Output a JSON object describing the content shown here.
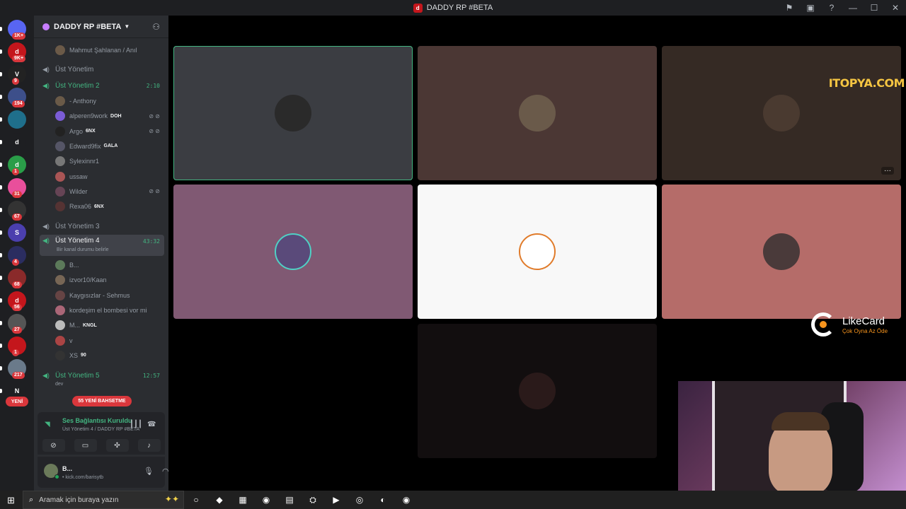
{
  "window": {
    "title": "DADDY RP #BETA",
    "controls": [
      "flag-icon",
      "monitor-icon",
      "help-icon",
      "minimize-icon",
      "maximize-icon",
      "close-icon"
    ]
  },
  "rail": {
    "servers": [
      {
        "label": "",
        "badge": "1K+",
        "color": "#5865f2"
      },
      {
        "label": "d",
        "badge": "9K+",
        "color": "#c4161c"
      },
      {
        "label": "V",
        "badge": "9",
        "color": "#222"
      },
      {
        "label": "",
        "badge": "194",
        "color": "#3d4f8a"
      },
      {
        "label": "",
        "badge": "",
        "color": "#1f6f8b"
      },
      {
        "label": "d",
        "badge": "",
        "color": "#1e1f22"
      },
      {
        "label": "d",
        "badge": "1",
        "color": "#2a9d48"
      },
      {
        "label": "",
        "badge": "31",
        "color": "#e94f9b"
      },
      {
        "label": "",
        "badge": "67",
        "color": "#333"
      },
      {
        "label": "S",
        "badge": "",
        "color": "#4b3fae"
      },
      {
        "label": "",
        "badge": "4",
        "color": "#2b2d60"
      },
      {
        "label": "",
        "badge": "68",
        "color": "#8a2a2a"
      },
      {
        "label": "d",
        "badge": "56",
        "color": "#c4161c"
      },
      {
        "label": "",
        "badge": "27",
        "color": "#555"
      },
      {
        "label": "",
        "badge": "1",
        "color": "#c4161c"
      },
      {
        "label": "",
        "badge": "217",
        "color": "#6a7a8a"
      },
      {
        "label": "N",
        "badge": "",
        "color": "#1e1f22"
      }
    ],
    "new_label": "YENİ"
  },
  "sidebar": {
    "guild_name": "DADDY RP #BETA",
    "top_user": "Mahmut Şahlanan / Anıl",
    "channels": [
      {
        "name": "Üst Yönetim",
        "time": "",
        "live": false
      },
      {
        "name": "Üst Yönetim 2",
        "time": "2:10",
        "live": true
      },
      {
        "name": "Üst Yönetim 3",
        "time": "",
        "live": false
      },
      {
        "name": "Üst Yönetim 4",
        "time": "43:32",
        "live": true,
        "sub": "Bir kanal durumu belirle"
      },
      {
        "name": "Üst Yönetim 5",
        "time": "12:57",
        "live": true,
        "sub": "dev"
      }
    ],
    "group2_users": [
      {
        "name": "- Anthony",
        "tag": "",
        "muted": false
      },
      {
        "name": "alperen9work",
        "tag": "DOH",
        "muted": true
      },
      {
        "name": "Argo",
        "tag": "6NX",
        "muted": true
      },
      {
        "name": "Edward9fix",
        "tag": "GALA",
        "muted": false
      },
      {
        "name": "Sylexinnr1",
        "tag": "",
        "muted": false
      },
      {
        "name": "ussaw",
        "tag": "",
        "muted": false
      },
      {
        "name": "Wilder",
        "tag": "",
        "muted": true
      },
      {
        "name": "Rexa06",
        "tag": "6NX",
        "muted": false
      }
    ],
    "group4_users": [
      {
        "name": "B...",
        "tag": ""
      },
      {
        "name": "izvor10/Kaan",
        "tag": ""
      },
      {
        "name": "Kaygısızlar - Sehmus",
        "tag": ""
      },
      {
        "name": "kordeşim el bombesi vor mi",
        "tag": ""
      },
      {
        "name": "M...",
        "tag": "KNGL"
      },
      {
        "name": "v",
        "tag": ""
      },
      {
        "name": "XS",
        "tag": "90"
      }
    ],
    "mentions_badge": "55 YENİ BAHSETME"
  },
  "voice_panel": {
    "status": "Ses Bağlantısı Kuruldu",
    "channel": "Üst Yönetim 4 / DADDY RP #BETA"
  },
  "user_panel": {
    "name": "B...",
    "sub": "• kick.com/barisytb"
  },
  "grid": {
    "tiles": [
      {
        "bg": "#3b3d42",
        "avatar": "#2a2a2a",
        "speaking": true
      },
      {
        "bg": "#4b3734",
        "avatar": "#6a5a4a",
        "speaking": false
      },
      {
        "bg": "#352a24",
        "avatar": "#4a3a30",
        "speaking": false
      },
      {
        "bg": "#805973",
        "avatar": "#5a4a7a",
        "speaking": false
      },
      {
        "bg": "#f8f8f8",
        "avatar": "#ffffff",
        "speaking": false
      },
      {
        "bg": "#b56c69",
        "avatar": "#4a3a3a",
        "speaking": false
      },
      {
        "bg": "#120e0f",
        "avatar": "#2a1a1a",
        "speaking": false
      }
    ],
    "watermark": "ITOPYA.COM",
    "sponsor_name": "LikeCard",
    "sponsor_tagline": "Çok Oyna  Az Öde"
  },
  "taskbar": {
    "search_placeholder": "Aramak için buraya yazın",
    "apps": [
      "cortana-icon",
      "app-icon",
      "store-icon",
      "chrome-icon",
      "files-icon",
      "steam-icon",
      "app2-icon",
      "app3-icon",
      "discord-icon",
      "chrome2-icon"
    ]
  }
}
